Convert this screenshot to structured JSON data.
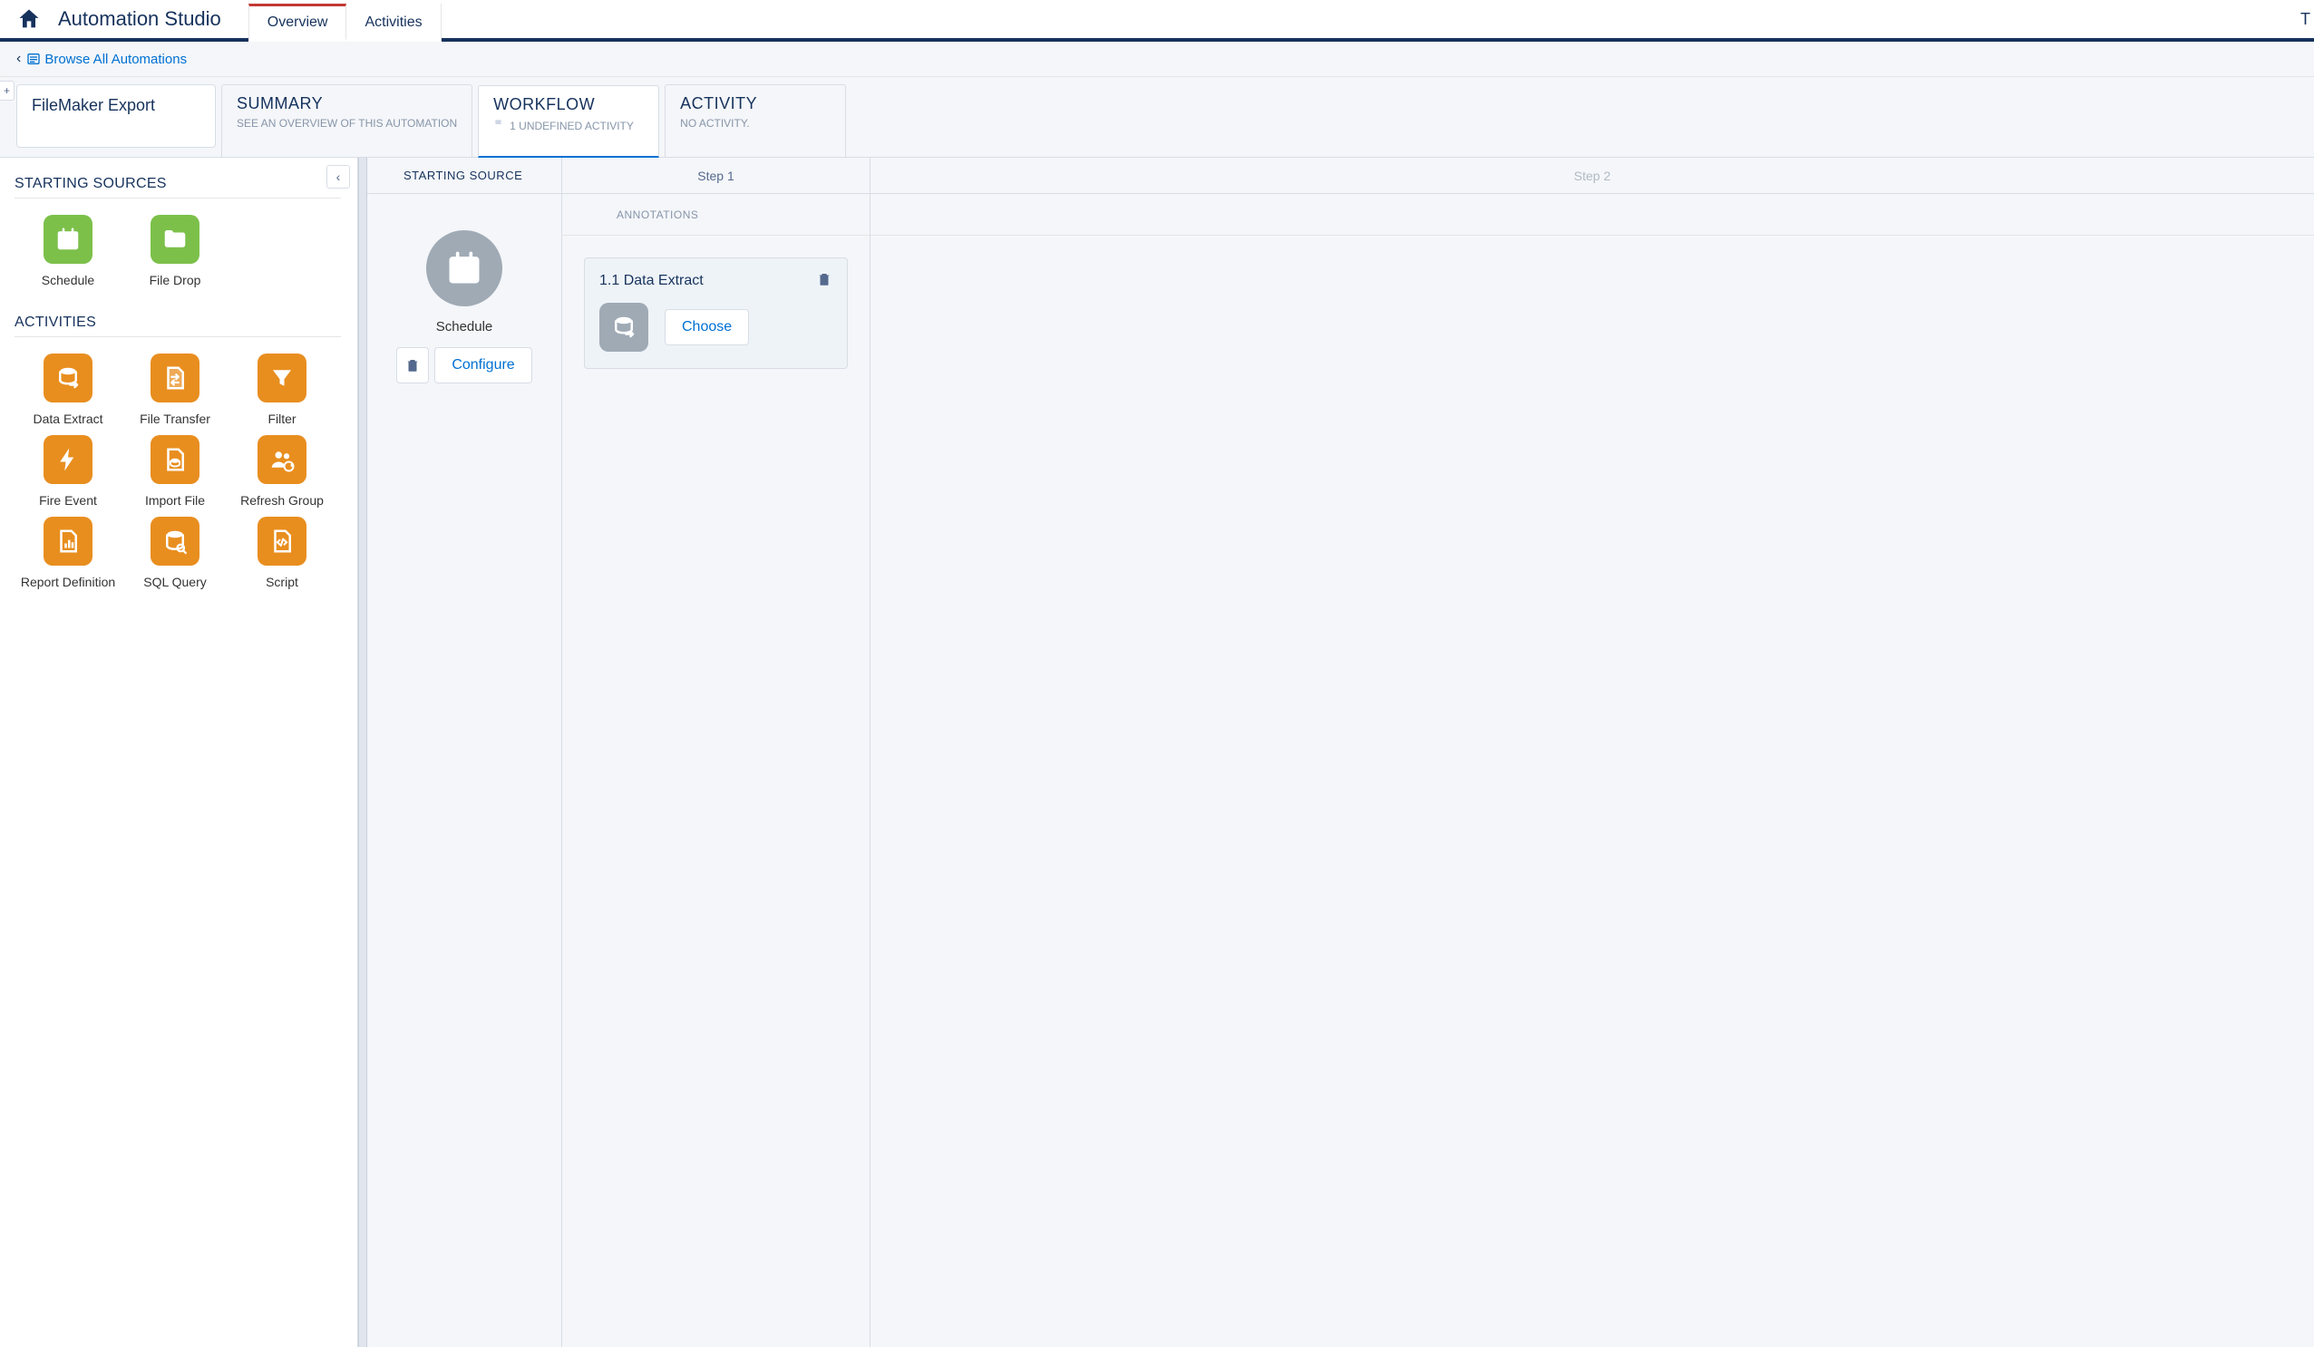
{
  "header": {
    "app_title": "Automation Studio",
    "tabs": {
      "overview": "Overview",
      "activities": "Activities"
    },
    "right_letter": "T"
  },
  "breadcrumb": {
    "link": "Browse All Automations"
  },
  "detail": {
    "automation_name": "FileMaker Export",
    "summary": {
      "title": "SUMMARY",
      "sub": "SEE AN OVERVIEW OF THIS AUTOMATION"
    },
    "workflow": {
      "title": "WORKFLOW",
      "sub": "1 UNDEFINED ACTIVITY"
    },
    "activity": {
      "title": "ACTIVITY",
      "sub": "NO ACTIVITY."
    }
  },
  "palette": {
    "sources_heading": "STARTING SOURCES",
    "activities_heading": "ACTIVITIES",
    "sources": {
      "schedule": "Schedule",
      "file_drop": "File Drop"
    },
    "activities": {
      "data_extract": "Data Extract",
      "file_transfer": "File Transfer",
      "filter": "Filter",
      "fire_event": "Fire Event",
      "import_file": "Import File",
      "refresh_group": "Refresh Group",
      "report_definition": "Report Definition",
      "sql_query": "SQL Query",
      "script": "Script"
    }
  },
  "canvas": {
    "source_header": "STARTING SOURCE",
    "annotations_label": "ANNOTATIONS",
    "steps": {
      "step1": "Step 1",
      "step2": "Step 2"
    },
    "source_block": {
      "label": "Schedule",
      "configure_btn": "Configure"
    },
    "step1_card": {
      "title": "1.1 Data Extract",
      "choose_btn": "Choose"
    }
  }
}
